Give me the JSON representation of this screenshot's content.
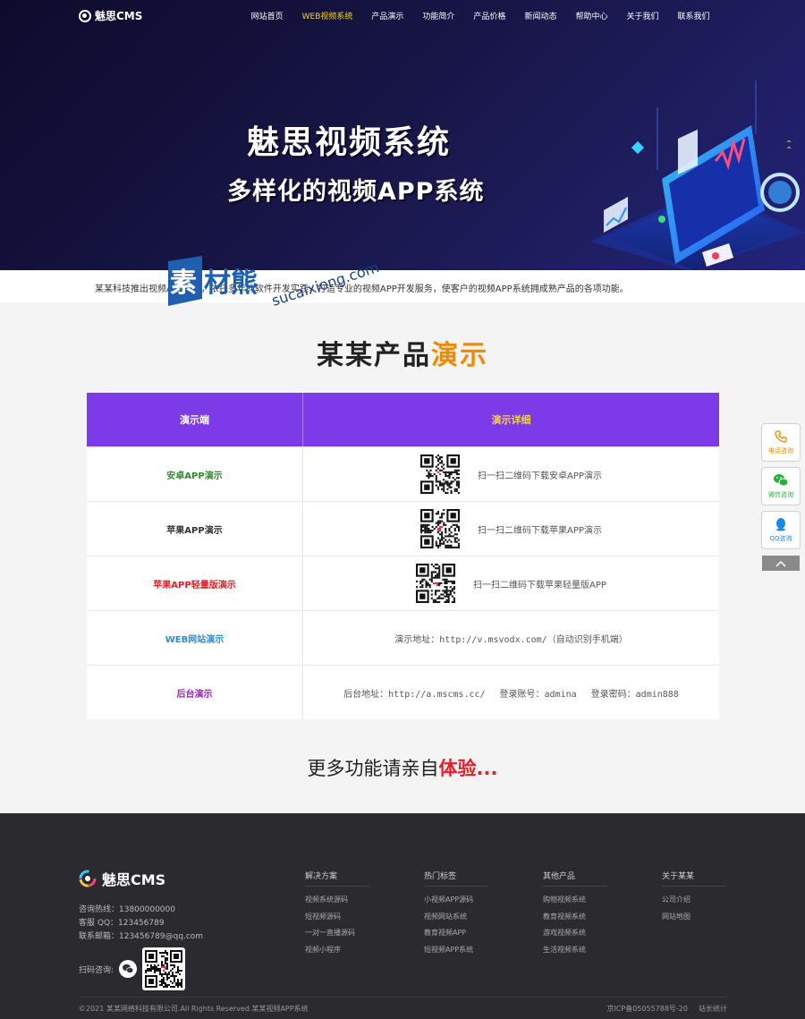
{
  "nav": {
    "logo_text": "魅思CMS",
    "items": [
      {
        "label": "网站首页"
      },
      {
        "label": "WEB视频系统"
      },
      {
        "label": "产品演示"
      },
      {
        "label": "功能简介"
      },
      {
        "label": "产品价格"
      },
      {
        "label": "新闻动态"
      },
      {
        "label": "帮助中心"
      },
      {
        "label": "关于我们"
      },
      {
        "label": "联系我们"
      }
    ]
  },
  "hero": {
    "title": "魅思视频系统",
    "subtitle": "多样化的视频APP系统"
  },
  "intro": {
    "text": "某某科技推出视频APP系统，依托多年的软件开发实践，打造专业的视频APP开发服务，使客户的视频APP系统拥成熟产品的各项功能。"
  },
  "watermark": {
    "text": "素材熊 sucaixiong.com"
  },
  "section": {
    "title_main": "某某产品",
    "title_highlight": "演示"
  },
  "table": {
    "headers": [
      "演示端",
      "演示详细"
    ],
    "rows": [
      {
        "name": "安卓APP演示",
        "detail": "扫一扫二维码下载安卓APP演示"
      },
      {
        "name": "苹果APP演示",
        "detail": "扫一扫二维码下载苹果APP演示"
      },
      {
        "name": "苹果APP轻量版演示",
        "detail": "扫一扫二维码下载苹果轻量版APP"
      },
      {
        "name": "WEB网站演示",
        "detail": "演示地址：http://v.msvodx.com/（自动识别手机端）"
      },
      {
        "name": "后台演示",
        "detail_addr": "后台地址：http://a.mscms.cc/",
        "detail_user": "登录账号：admina",
        "detail_pass": "登录密码：admin888"
      }
    ]
  },
  "more": {
    "text": "更多功能请亲自",
    "highlight": "体验..."
  },
  "side": {
    "phone_label": "电话咨询",
    "wechat_label": "微信咨询",
    "qq_label": "QQ咨询"
  },
  "footer": {
    "logo_text": "魅思CMS",
    "hotline": "咨询热线：13800000000",
    "qq": "客服 QQ：123456789",
    "email": "联系邮箱：123456789@qq.com",
    "scan_label": "扫码咨询:",
    "columns": [
      {
        "title": "解决方案",
        "links": [
          "视频系统源码",
          "短视频源码",
          "一对一直播源码",
          "视频小程序"
        ]
      },
      {
        "title": "热门标签",
        "links": [
          "小视频APP源码",
          "视频网站系统",
          "教育视频APP",
          "短视频APP系统"
        ]
      },
      {
        "title": "其他产品",
        "links": [
          "购物视频系统",
          "教育视频系统",
          "游戏视频系统",
          "生活视频系统"
        ]
      },
      {
        "title": "关于某某",
        "links": [
          "公司介绍",
          "网站地图"
        ]
      }
    ],
    "copyright": "©2021 某某网络科技有限公司.All Rights Reserved.某某视频APP系统",
    "icp": "京ICP备05055788号-20",
    "stats": "站长统计"
  }
}
